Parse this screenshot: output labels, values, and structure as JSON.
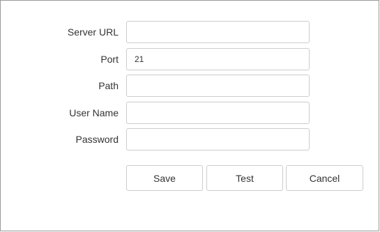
{
  "form": {
    "fields": [
      {
        "label": "Server URL",
        "value": "",
        "placeholder": ""
      },
      {
        "label": "Port",
        "value": "21",
        "placeholder": ""
      },
      {
        "label": "Path",
        "value": "",
        "placeholder": ""
      },
      {
        "label": "User Name",
        "value": "",
        "placeholder": ""
      },
      {
        "label": "Password",
        "value": "",
        "placeholder": ""
      }
    ]
  },
  "buttons": {
    "save_label": "Save",
    "test_label": "Test",
    "cancel_label": "Cancel"
  }
}
